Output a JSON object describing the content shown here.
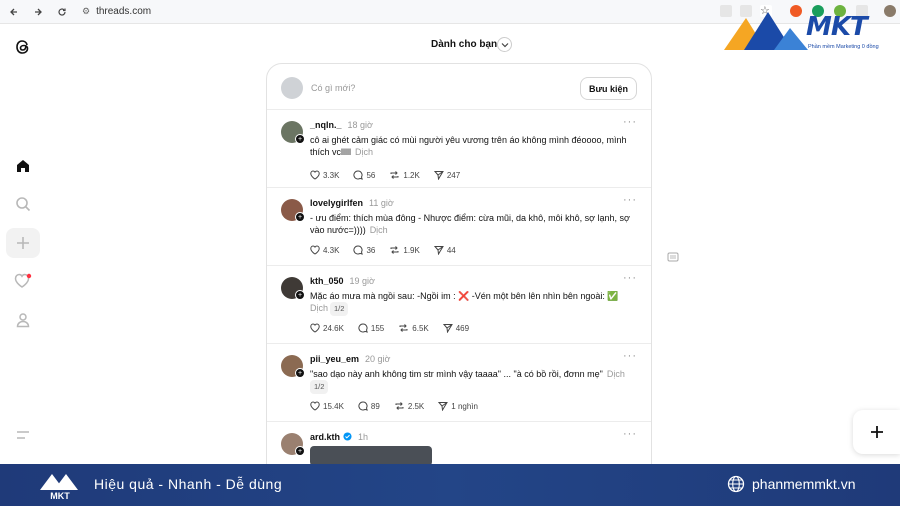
{
  "browser": {
    "url": "threads.com",
    "back_icon": "back-arrow-icon",
    "forward_icon": "forward-arrow-icon",
    "reload_icon": "reload-icon"
  },
  "brand_overlay": {
    "logo_text": "MKT",
    "logo_subtitle": "Phần mềm Marketing 0 đồng"
  },
  "feed": {
    "title": "Dành cho bạn",
    "composer_placeholder": "Có gì mới?",
    "post_button": "Bưu kiện"
  },
  "posts": [
    {
      "username": "_nqln._",
      "time": "18 giờ",
      "text": "cô ai ghét cảm giác có mùi người yêu vương trên áo không mình đéoooo, mình thích vclllll",
      "translate": "Dịch",
      "page_badge": "",
      "likes": "3.3K",
      "comments": "56",
      "reposts": "1.2K",
      "shares": "247",
      "avatar_color": "#6b7563"
    },
    {
      "username": "lovelygirlfen",
      "time": "11 giờ",
      "text": "- ưu điểm: thích mùa đông - Nhược điểm: cừa mũi, da khô, môi khô, sợ lạnh, sợ vào nước=))))",
      "translate": "Dịch",
      "page_badge": "",
      "likes": "4.3K",
      "comments": "36",
      "reposts": "1.9K",
      "shares": "44",
      "avatar_color": "#8a5a48"
    },
    {
      "username": "kth_050",
      "time": "19 giờ",
      "text": "Mặc áo mưa mà ngồi sau: -Ngồi im : ❌ -Vén một bên lên nhìn bên ngoài: ✅",
      "translate": "Dịch",
      "page_badge": "1/2",
      "likes": "24.6K",
      "comments": "155",
      "reposts": "6.5K",
      "shares": "469",
      "avatar_color": "#3f3a36"
    },
    {
      "username": "pii_yeu_em",
      "time": "20 giờ",
      "text": "\"sao dạo này anh không tim str mình vậy taaaa\" ... \"à có bồ rồi, đơnn mẹ\"",
      "translate": "Dịch",
      "page_badge": "1/2",
      "likes": "15.4K",
      "comments": "89",
      "reposts": "2.5K",
      "shares": "1 nghìn",
      "avatar_color": "#8b6a52"
    },
    {
      "username": "ard.kth",
      "time": "1h",
      "verified": true,
      "avatar_color": "#9a8070"
    }
  ],
  "banner": {
    "slogan": "Hiệu quả - Nhanh - Dễ dùng",
    "site": "phanmemmkt.vn",
    "logo_text": "MKT"
  }
}
